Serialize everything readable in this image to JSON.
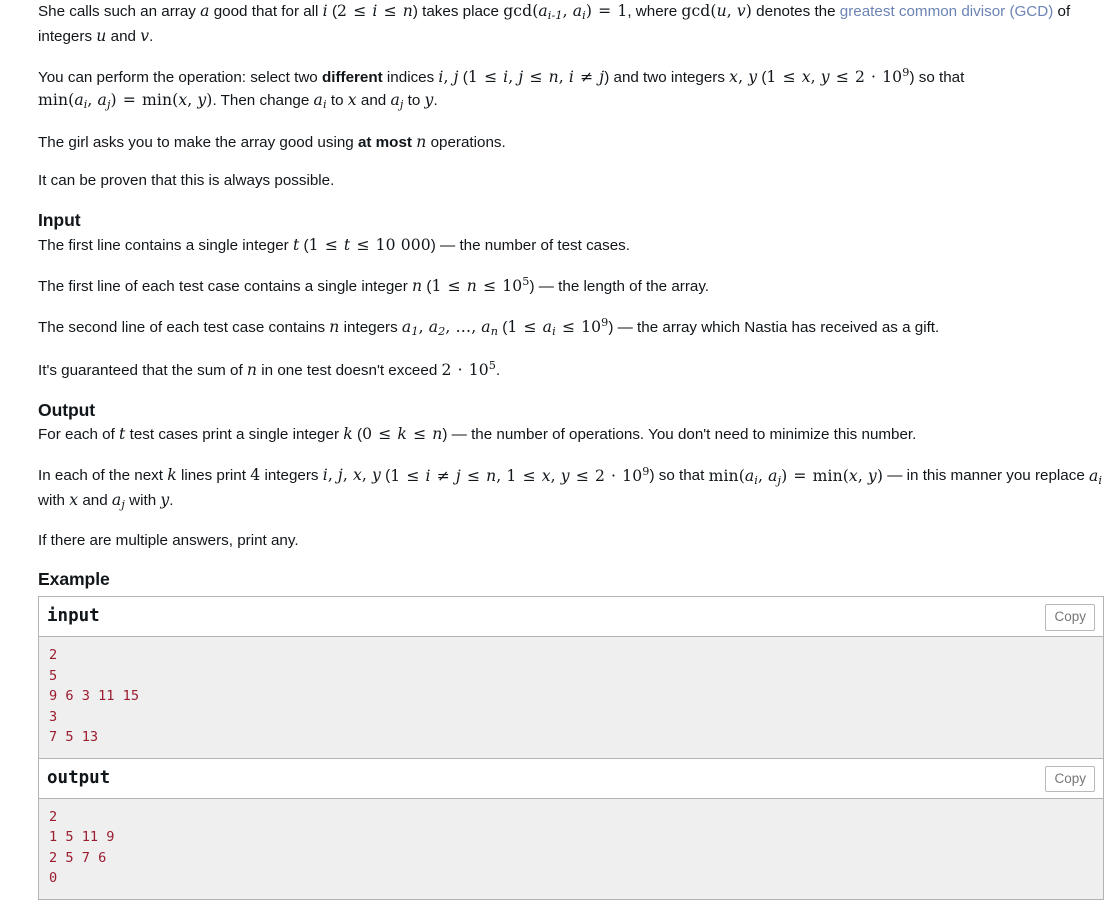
{
  "statement": {
    "paragraphs": [
      {
        "id": "good-array-def",
        "segments": [
          {
            "t": "text",
            "v": "She calls such an array "
          },
          {
            "t": "math",
            "v": "a"
          },
          {
            "t": "text",
            "v": " good that for all "
          },
          {
            "t": "math",
            "v": "i"
          },
          {
            "t": "text",
            "v": " ("
          },
          {
            "t": "math",
            "v": "2 ≤ i ≤ n"
          },
          {
            "t": "text",
            "v": ") takes place "
          },
          {
            "t": "math",
            "v": "gcd(a_{i-1}, a_i) = 1"
          },
          {
            "t": "text",
            "v": ", where "
          },
          {
            "t": "math",
            "v": "gcd(u, v)"
          },
          {
            "t": "text",
            "v": " denotes the "
          },
          {
            "t": "link",
            "v": "greatest common divisor (GCD)"
          },
          {
            "t": "text",
            "v": " of integers "
          },
          {
            "t": "math",
            "v": "u"
          },
          {
            "t": "text",
            "v": " and "
          },
          {
            "t": "math",
            "v": "v"
          },
          {
            "t": "text",
            "v": "."
          }
        ]
      },
      {
        "id": "operation-def",
        "segments": [
          {
            "t": "text",
            "v": "You can perform the operation: select two "
          },
          {
            "t": "bold",
            "v": "different"
          },
          {
            "t": "text",
            "v": " indices "
          },
          {
            "t": "math",
            "v": "i, j"
          },
          {
            "t": "text",
            "v": " ("
          },
          {
            "t": "math",
            "v": "1 ≤ i, j ≤ n, i ≠ j"
          },
          {
            "t": "text",
            "v": ") and two integers "
          },
          {
            "t": "math",
            "v": "x, y"
          },
          {
            "t": "text",
            "v": " ("
          },
          {
            "t": "math",
            "v": "1 ≤ x, y ≤ 2 · 10^9"
          },
          {
            "t": "text",
            "v": ") so that "
          },
          {
            "t": "math",
            "v": "min(a_i, a_j) = min(x, y)"
          },
          {
            "t": "text",
            "v": ". Then change "
          },
          {
            "t": "math",
            "v": "a_i"
          },
          {
            "t": "text",
            "v": " to "
          },
          {
            "t": "math",
            "v": "x"
          },
          {
            "t": "text",
            "v": " and "
          },
          {
            "t": "math",
            "v": "a_j"
          },
          {
            "t": "text",
            "v": " to "
          },
          {
            "t": "math",
            "v": "y"
          },
          {
            "t": "text",
            "v": "."
          }
        ]
      },
      {
        "id": "at-most-n-ops",
        "segments": [
          {
            "t": "text",
            "v": "The girl asks you to make the array good using "
          },
          {
            "t": "bold",
            "v": "at most"
          },
          {
            "t": "text",
            "v": " "
          },
          {
            "t": "math",
            "v": "n"
          },
          {
            "t": "text",
            "v": " operations."
          }
        ]
      },
      {
        "id": "always-possible",
        "segments": [
          {
            "t": "text",
            "v": "It can be proven that this is always possible."
          }
        ]
      }
    ]
  },
  "input_section": {
    "title": "Input",
    "paragraphs": [
      {
        "id": "input-t",
        "segments": [
          {
            "t": "text",
            "v": "The first line contains a single integer "
          },
          {
            "t": "math",
            "v": "t"
          },
          {
            "t": "text",
            "v": " ("
          },
          {
            "t": "math",
            "v": "1 ≤ t ≤ 10 000"
          },
          {
            "t": "text",
            "v": ") — the number of test cases."
          }
        ]
      },
      {
        "id": "input-n",
        "segments": [
          {
            "t": "text",
            "v": "The first line of each test case contains a single integer "
          },
          {
            "t": "math",
            "v": "n"
          },
          {
            "t": "text",
            "v": " ("
          },
          {
            "t": "math",
            "v": "1 ≤ n ≤ 10^5"
          },
          {
            "t": "text",
            "v": ") — the length of the array."
          }
        ]
      },
      {
        "id": "input-array",
        "segments": [
          {
            "t": "text",
            "v": "The second line of each test case contains "
          },
          {
            "t": "math",
            "v": "n"
          },
          {
            "t": "text",
            "v": " integers "
          },
          {
            "t": "math",
            "v": "a_1, a_2, …, a_n"
          },
          {
            "t": "text",
            "v": " ("
          },
          {
            "t": "math",
            "v": "1 ≤ a_i ≤ 10^9"
          },
          {
            "t": "text",
            "v": ") — the array which Nastia has received as a gift."
          }
        ]
      },
      {
        "id": "input-sum",
        "segments": [
          {
            "t": "text",
            "v": "It's guaranteed that the sum of "
          },
          {
            "t": "math",
            "v": "n"
          },
          {
            "t": "text",
            "v": " in one test doesn't exceed "
          },
          {
            "t": "math",
            "v": "2 · 10^5"
          },
          {
            "t": "text",
            "v": "."
          }
        ]
      }
    ]
  },
  "output_section": {
    "title": "Output",
    "paragraphs": [
      {
        "id": "output-k",
        "segments": [
          {
            "t": "text",
            "v": "For each of "
          },
          {
            "t": "math",
            "v": "t"
          },
          {
            "t": "text",
            "v": " test cases print a single integer "
          },
          {
            "t": "math",
            "v": "k"
          },
          {
            "t": "text",
            "v": " ("
          },
          {
            "t": "math",
            "v": "0 ≤ k ≤ n"
          },
          {
            "t": "text",
            "v": ") — the number of operations. You don't need to minimize this number."
          }
        ]
      },
      {
        "id": "output-lines",
        "segments": [
          {
            "t": "text",
            "v": "In each of the next "
          },
          {
            "t": "math",
            "v": "k"
          },
          {
            "t": "text",
            "v": " lines print "
          },
          {
            "t": "math",
            "v": "4"
          },
          {
            "t": "text",
            "v": " integers "
          },
          {
            "t": "math",
            "v": "i, j, x, y"
          },
          {
            "t": "text",
            "v": " ("
          },
          {
            "t": "math",
            "v": "1 ≤ i ≠ j ≤ n, 1 ≤ x, y ≤ 2 · 10^9"
          },
          {
            "t": "text",
            "v": ") so that "
          },
          {
            "t": "math",
            "v": "min(a_i, a_j) = min(x, y)"
          },
          {
            "t": "text",
            "v": " — in this manner you replace "
          },
          {
            "t": "math",
            "v": "a_i"
          },
          {
            "t": "text",
            "v": " with "
          },
          {
            "t": "math",
            "v": "x"
          },
          {
            "t": "text",
            "v": " and "
          },
          {
            "t": "math",
            "v": "a_j"
          },
          {
            "t": "text",
            "v": " with "
          },
          {
            "t": "math",
            "v": "y"
          },
          {
            "t": "text",
            "v": "."
          }
        ]
      },
      {
        "id": "output-any",
        "segments": [
          {
            "t": "text",
            "v": "If there are multiple answers, print any."
          }
        ]
      }
    ]
  },
  "example": {
    "heading": "Example",
    "tests": [
      {
        "label": "input",
        "copy_label": "Copy",
        "content": "2\n5\n9 6 3 11 15\n3\n7 5 13"
      },
      {
        "label": "output",
        "copy_label": "Copy",
        "content": "2\n1 5 11 9\n2 5 7 6\n0"
      }
    ]
  },
  "colors": {
    "link": "#6b84b4",
    "sample_text": "#9b1c2e",
    "sample_bg": "#efefef",
    "border": "#b3b3b3",
    "body_text": "#11161a"
  }
}
